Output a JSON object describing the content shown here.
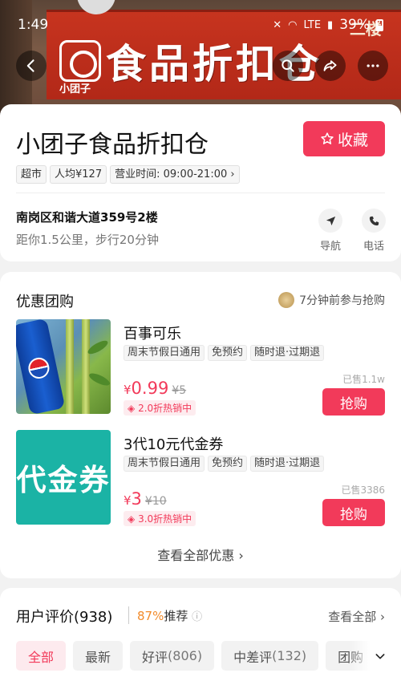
{
  "status_bar": {
    "time": "1:49",
    "network": "LTE",
    "battery": "39%"
  },
  "hero": {
    "sign_text": "食品折扣仓",
    "sign_brand": "小团子",
    "sign_floor": "二楼"
  },
  "store": {
    "name": "小团子食品折扣仓",
    "favorite_label": "收藏",
    "tags": [
      "超市",
      "人均¥127",
      "营业时间: 09:00-21:00"
    ],
    "address": "南岗区和谐大道359号2楼",
    "distance": "距你1.5公里，步行20分钟",
    "navigate_label": "导航",
    "phone_label": "电话"
  },
  "deals": {
    "title": "优惠团购",
    "joined_text": "7分钟前参与抢购",
    "items": [
      {
        "title": "百事可乐",
        "tags": [
          "周末节假日通用",
          "免预约",
          "随时退·过期退"
        ],
        "currency": "¥",
        "price": "0.99",
        "old_price": "¥5",
        "hot": "2.0折热销中",
        "sold": "已售1.1w",
        "buy_label": "抢购"
      },
      {
        "title": "3代10元代金券",
        "thumb_text": "代金券",
        "tags": [
          "周末节假日通用",
          "免预约",
          "随时退·过期退"
        ],
        "currency": "¥",
        "price": "3",
        "old_price": "¥10",
        "hot": "3.0折热销中",
        "sold": "已售3386",
        "buy_label": "抢购"
      }
    ],
    "view_all": "查看全部优惠"
  },
  "reviews": {
    "title": "用户评价(938)",
    "recommend_pct": "87%",
    "recommend_label": "推荐",
    "see_all": "查看全部",
    "filters": [
      {
        "label": "全部",
        "count": ""
      },
      {
        "label": "最新",
        "count": ""
      },
      {
        "label": "好评",
        "count": "(806)"
      },
      {
        "label": "中差评",
        "count": "(132)"
      },
      {
        "label": "团购",
        "count": ""
      }
    ]
  },
  "colors": {
    "accent": "#f23a5a",
    "recommend": "#f28b2b",
    "voucher_bg": "#1bb3a5"
  }
}
